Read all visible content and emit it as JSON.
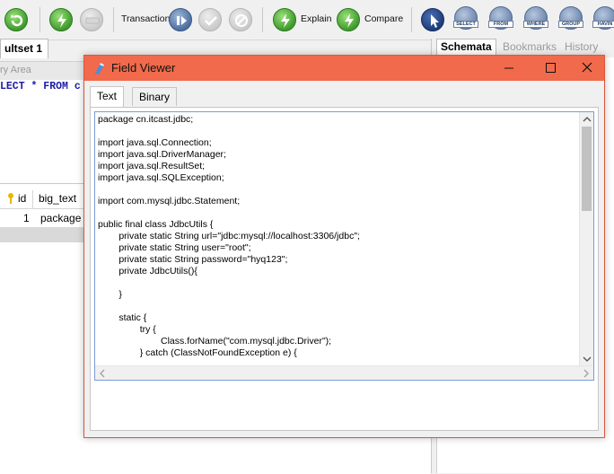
{
  "toolbar": {
    "transaction_label": "Transaction",
    "explain_label": "Explain",
    "compare_label": "Compare",
    "sql_buttons": [
      "SELECT",
      "FROM",
      "WHERE",
      "GROUP",
      "HAVIN"
    ]
  },
  "editor": {
    "result_tab": "ultset 1",
    "query_area_label": "ry Area",
    "sql_fragment": "LECT * FROM c"
  },
  "grid": {
    "columns": [
      "id",
      "big_text"
    ],
    "row": {
      "id": "1",
      "big_text": "package c"
    }
  },
  "right_tabs": {
    "schemata": "Schemata",
    "bookmarks": "Bookmarks",
    "history": "History"
  },
  "dialog": {
    "title": "Field Viewer",
    "tabs": [
      "Text",
      "Binary"
    ],
    "content": "package cn.itcast.jdbc;\n\nimport java.sql.Connection;\nimport java.sql.DriverManager;\nimport java.sql.ResultSet;\nimport java.sql.SQLException;\n\nimport com.mysql.jdbc.Statement;\n\npublic final class JdbcUtils {\n\tprivate static String url=\"jdbc:mysql://localhost:3306/jdbc\";\n\tprivate static String user=\"root\";\n\tprivate static String password=\"hyq123\";\n\tprivate JdbcUtils(){\n\n\t}\n\n\tstatic {\n\t\ttry {\n\t\t\tClass.forName(\"com.mysql.jdbc.Driver\");\n\t\t} catch (ClassNotFoundException e) {"
  },
  "colors": {
    "titlebar": "#f06a4b",
    "sql_keyword": "#1b1ba8"
  }
}
